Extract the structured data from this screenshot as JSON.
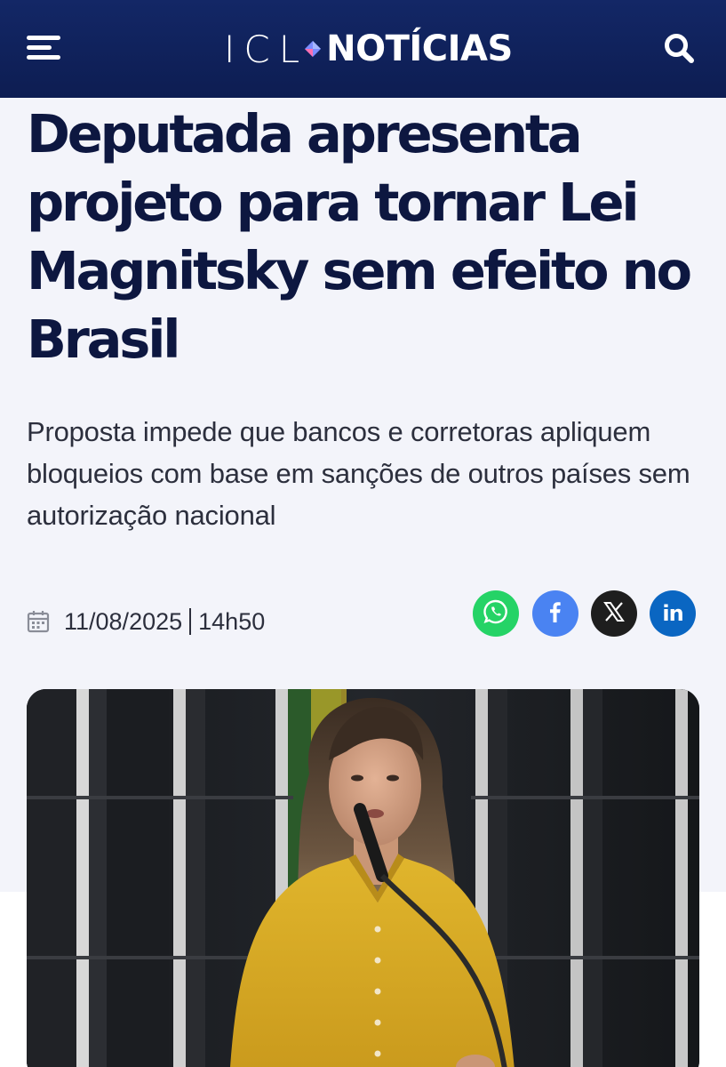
{
  "header": {
    "logo_left": "ICL",
    "logo_right": "NOTÍCIAS",
    "menu_icon": "hamburger-menu-icon",
    "search_icon": "search-icon",
    "background": "#0f2160"
  },
  "article": {
    "headline": "Deputada apresenta projeto para tornar Lei Magnitsky sem efeito no Brasil",
    "subtitle": "Proposta impede que bancos e corretoras apliquem bloqueios com base em sanções de outros países sem autorização nacional",
    "date": "11/08/2025",
    "time": "14h50",
    "date_icon": "calendar-icon"
  },
  "share": {
    "whatsapp": {
      "icon": "whatsapp-icon",
      "color": "#25d366"
    },
    "facebook": {
      "icon": "facebook-icon",
      "color": "#4a83f2"
    },
    "x": {
      "icon": "x-icon",
      "color": "#1e1e1e"
    },
    "linkedin": {
      "icon": "linkedin-icon",
      "label": "in",
      "color": "#0a66c2"
    }
  },
  "photo": {
    "description_icon": "article-photo"
  }
}
